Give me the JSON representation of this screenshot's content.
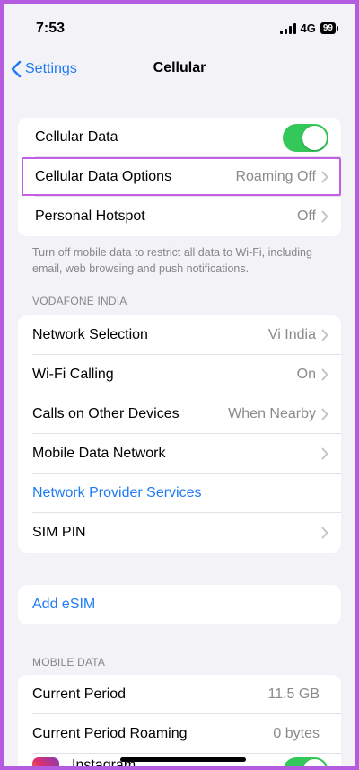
{
  "status_bar": {
    "time": "7:53",
    "network": "4G",
    "battery": "99"
  },
  "nav": {
    "back_label": "Settings",
    "title": "Cellular"
  },
  "group1": {
    "cellular_data": {
      "label": "Cellular Data"
    },
    "cellular_data_options": {
      "label": "Cellular Data Options",
      "value": "Roaming Off"
    },
    "personal_hotspot": {
      "label": "Personal Hotspot",
      "value": "Off"
    }
  },
  "footnote": "Turn off mobile data to restrict all data to Wi-Fi, including email, web browsing and push notifications.",
  "carrier_section": {
    "header": "VODAFONE INDIA",
    "network_selection": {
      "label": "Network Selection",
      "value": "Vi India"
    },
    "wifi_calling": {
      "label": "Wi-Fi Calling",
      "value": "On"
    },
    "calls_other_devices": {
      "label": "Calls on Other Devices",
      "value": "When Nearby"
    },
    "mobile_data_network": {
      "label": "Mobile Data Network"
    },
    "network_provider_services": {
      "label": "Network Provider Services"
    },
    "sim_pin": {
      "label": "SIM PIN"
    }
  },
  "esim": {
    "label": "Add eSIM"
  },
  "mobile_data_section": {
    "header": "MOBILE DATA",
    "current_period": {
      "label": "Current Period",
      "value": "11.5 GB"
    },
    "current_period_roaming": {
      "label": "Current Period Roaming",
      "value": "0 bytes"
    },
    "instagram": {
      "label": "Instagram"
    }
  },
  "colors": {
    "accent": "#1e7bf5",
    "toggle_on": "#34c759",
    "highlight": "#c25fe6",
    "background": "#f2f2f7"
  }
}
